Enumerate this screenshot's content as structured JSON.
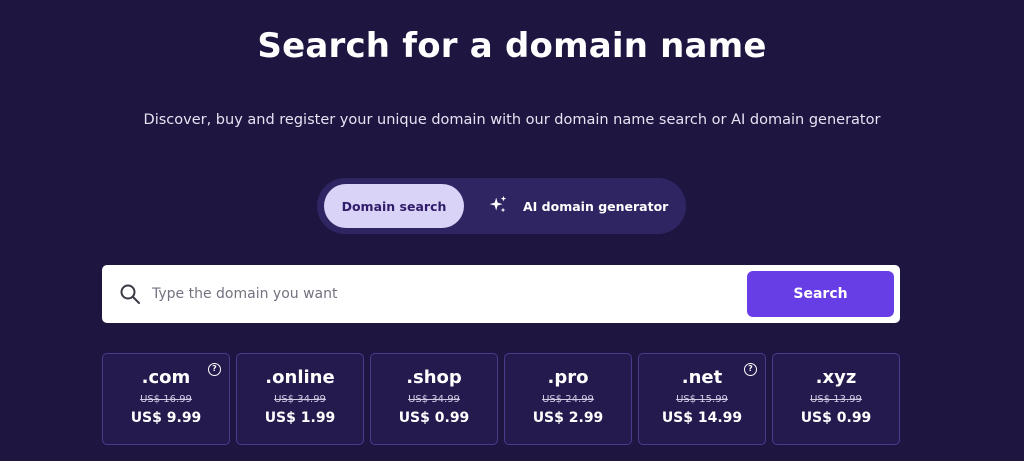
{
  "header": {
    "title": "Search for a domain name",
    "subtitle": "Discover, buy and register your unique domain with our domain name search or AI domain generator"
  },
  "toggle": {
    "domain_search_label": "Domain search",
    "ai_generator_label": "AI domain generator",
    "ai_icon": "sparkles-icon",
    "active": "Domain search"
  },
  "search": {
    "placeholder": "Type the domain you want",
    "value": "",
    "button_label": "Search",
    "icon": "search-icon"
  },
  "colors": {
    "background": "#1f1541",
    "accent": "#673de6",
    "active_tab": "#d9d3f7",
    "card_border": "#4a3a8e"
  },
  "tlds": [
    {
      "name": ".com",
      "old_price": "US$ 16.99",
      "new_price": "US$ 9.99",
      "help": "?"
    },
    {
      "name": ".online",
      "old_price": "US$ 34.99",
      "new_price": "US$ 1.99"
    },
    {
      "name": ".shop",
      "old_price": "US$ 34.99",
      "new_price": "US$ 0.99"
    },
    {
      "name": ".pro",
      "old_price": "US$ 24.99",
      "new_price": "US$ 2.99"
    },
    {
      "name": ".net",
      "old_price": "US$ 15.99",
      "new_price": "US$ 14.99",
      "help": "?"
    },
    {
      "name": ".xyz",
      "old_price": "US$ 13.99",
      "new_price": "US$ 0.99"
    }
  ]
}
